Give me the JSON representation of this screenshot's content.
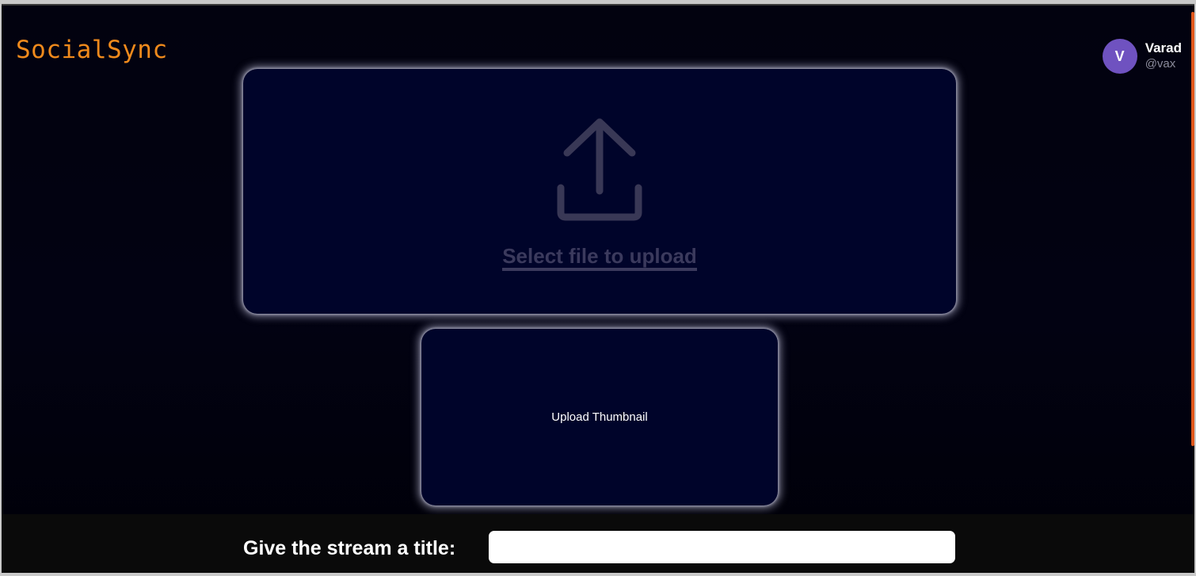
{
  "app": {
    "brand": "SocialSync",
    "accent_color": "#f08a1c"
  },
  "user": {
    "initial": "V",
    "name": "Varad",
    "handle": "@vax",
    "avatar_color": "#6f52c0"
  },
  "upload": {
    "icon": "upload-icon",
    "label": "Select file to upload"
  },
  "thumbnail": {
    "label": "Upload Thumbnail"
  },
  "title_form": {
    "label": "Give the stream a title:",
    "value": "",
    "placeholder": ""
  }
}
